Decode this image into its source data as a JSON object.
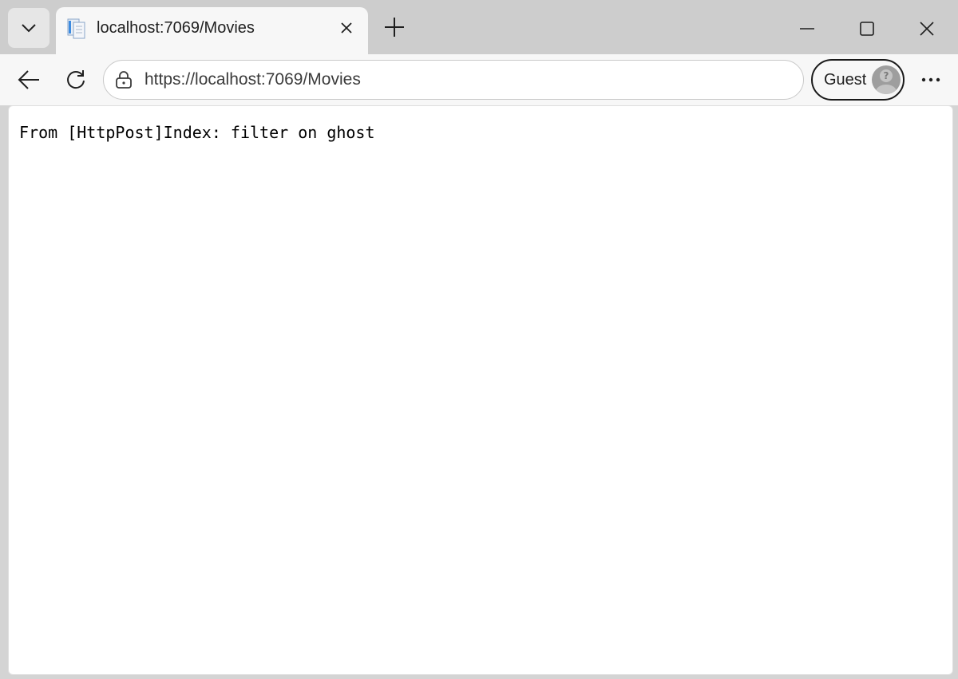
{
  "tab": {
    "title": "localhost:7069/Movies"
  },
  "address_bar": {
    "url": "https://localhost:7069/Movies"
  },
  "profile": {
    "label": "Guest"
  },
  "page": {
    "text": "From [HttpPost]Index: filter on ghost"
  },
  "icons": {
    "tab_list": "chevron-down-icon",
    "favicon": "page-favicon-icon",
    "tab_close": "close-icon",
    "new_tab": "plus-icon",
    "minimize": "minimize-icon",
    "maximize": "maximize-icon",
    "close_window": "close-icon",
    "back": "back-arrow-icon",
    "refresh": "refresh-icon",
    "site_info": "lock-icon",
    "avatar": "guest-avatar-icon",
    "more": "more-dots-icon"
  },
  "colors": {
    "tab_strip": "#cdcdcd",
    "toolbar": "#f7f7f7",
    "content_bg": "#ffffff"
  }
}
